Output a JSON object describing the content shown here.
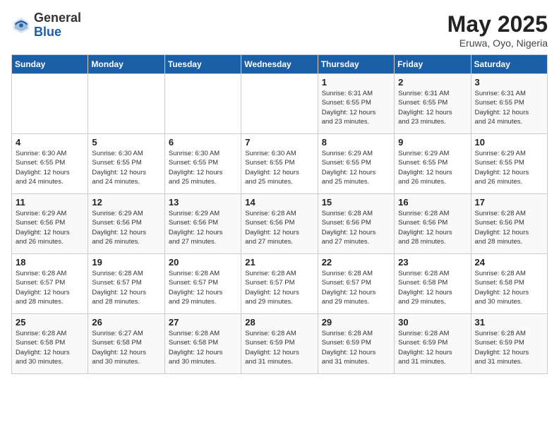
{
  "header": {
    "logo_general": "General",
    "logo_blue": "Blue",
    "month_year": "May 2025",
    "location": "Eruwa, Oyo, Nigeria"
  },
  "days_of_week": [
    "Sunday",
    "Monday",
    "Tuesday",
    "Wednesday",
    "Thursday",
    "Friday",
    "Saturday"
  ],
  "weeks": [
    [
      {
        "day": "",
        "info": ""
      },
      {
        "day": "",
        "info": ""
      },
      {
        "day": "",
        "info": ""
      },
      {
        "day": "",
        "info": ""
      },
      {
        "day": "1",
        "info": "Sunrise: 6:31 AM\nSunset: 6:55 PM\nDaylight: 12 hours\nand 23 minutes."
      },
      {
        "day": "2",
        "info": "Sunrise: 6:31 AM\nSunset: 6:55 PM\nDaylight: 12 hours\nand 23 minutes."
      },
      {
        "day": "3",
        "info": "Sunrise: 6:31 AM\nSunset: 6:55 PM\nDaylight: 12 hours\nand 24 minutes."
      }
    ],
    [
      {
        "day": "4",
        "info": "Sunrise: 6:30 AM\nSunset: 6:55 PM\nDaylight: 12 hours\nand 24 minutes."
      },
      {
        "day": "5",
        "info": "Sunrise: 6:30 AM\nSunset: 6:55 PM\nDaylight: 12 hours\nand 24 minutes."
      },
      {
        "day": "6",
        "info": "Sunrise: 6:30 AM\nSunset: 6:55 PM\nDaylight: 12 hours\nand 25 minutes."
      },
      {
        "day": "7",
        "info": "Sunrise: 6:30 AM\nSunset: 6:55 PM\nDaylight: 12 hours\nand 25 minutes."
      },
      {
        "day": "8",
        "info": "Sunrise: 6:29 AM\nSunset: 6:55 PM\nDaylight: 12 hours\nand 25 minutes."
      },
      {
        "day": "9",
        "info": "Sunrise: 6:29 AM\nSunset: 6:55 PM\nDaylight: 12 hours\nand 26 minutes."
      },
      {
        "day": "10",
        "info": "Sunrise: 6:29 AM\nSunset: 6:55 PM\nDaylight: 12 hours\nand 26 minutes."
      }
    ],
    [
      {
        "day": "11",
        "info": "Sunrise: 6:29 AM\nSunset: 6:56 PM\nDaylight: 12 hours\nand 26 minutes."
      },
      {
        "day": "12",
        "info": "Sunrise: 6:29 AM\nSunset: 6:56 PM\nDaylight: 12 hours\nand 26 minutes."
      },
      {
        "day": "13",
        "info": "Sunrise: 6:29 AM\nSunset: 6:56 PM\nDaylight: 12 hours\nand 27 minutes."
      },
      {
        "day": "14",
        "info": "Sunrise: 6:28 AM\nSunset: 6:56 PM\nDaylight: 12 hours\nand 27 minutes."
      },
      {
        "day": "15",
        "info": "Sunrise: 6:28 AM\nSunset: 6:56 PM\nDaylight: 12 hours\nand 27 minutes."
      },
      {
        "day": "16",
        "info": "Sunrise: 6:28 AM\nSunset: 6:56 PM\nDaylight: 12 hours\nand 28 minutes."
      },
      {
        "day": "17",
        "info": "Sunrise: 6:28 AM\nSunset: 6:56 PM\nDaylight: 12 hours\nand 28 minutes."
      }
    ],
    [
      {
        "day": "18",
        "info": "Sunrise: 6:28 AM\nSunset: 6:57 PM\nDaylight: 12 hours\nand 28 minutes."
      },
      {
        "day": "19",
        "info": "Sunrise: 6:28 AM\nSunset: 6:57 PM\nDaylight: 12 hours\nand 28 minutes."
      },
      {
        "day": "20",
        "info": "Sunrise: 6:28 AM\nSunset: 6:57 PM\nDaylight: 12 hours\nand 29 minutes."
      },
      {
        "day": "21",
        "info": "Sunrise: 6:28 AM\nSunset: 6:57 PM\nDaylight: 12 hours\nand 29 minutes."
      },
      {
        "day": "22",
        "info": "Sunrise: 6:28 AM\nSunset: 6:57 PM\nDaylight: 12 hours\nand 29 minutes."
      },
      {
        "day": "23",
        "info": "Sunrise: 6:28 AM\nSunset: 6:58 PM\nDaylight: 12 hours\nand 29 minutes."
      },
      {
        "day": "24",
        "info": "Sunrise: 6:28 AM\nSunset: 6:58 PM\nDaylight: 12 hours\nand 30 minutes."
      }
    ],
    [
      {
        "day": "25",
        "info": "Sunrise: 6:28 AM\nSunset: 6:58 PM\nDaylight: 12 hours\nand 30 minutes."
      },
      {
        "day": "26",
        "info": "Sunrise: 6:27 AM\nSunset: 6:58 PM\nDaylight: 12 hours\nand 30 minutes."
      },
      {
        "day": "27",
        "info": "Sunrise: 6:28 AM\nSunset: 6:58 PM\nDaylight: 12 hours\nand 30 minutes."
      },
      {
        "day": "28",
        "info": "Sunrise: 6:28 AM\nSunset: 6:59 PM\nDaylight: 12 hours\nand 31 minutes."
      },
      {
        "day": "29",
        "info": "Sunrise: 6:28 AM\nSunset: 6:59 PM\nDaylight: 12 hours\nand 31 minutes."
      },
      {
        "day": "30",
        "info": "Sunrise: 6:28 AM\nSunset: 6:59 PM\nDaylight: 12 hours\nand 31 minutes."
      },
      {
        "day": "31",
        "info": "Sunrise: 6:28 AM\nSunset: 6:59 PM\nDaylight: 12 hours\nand 31 minutes."
      }
    ]
  ]
}
